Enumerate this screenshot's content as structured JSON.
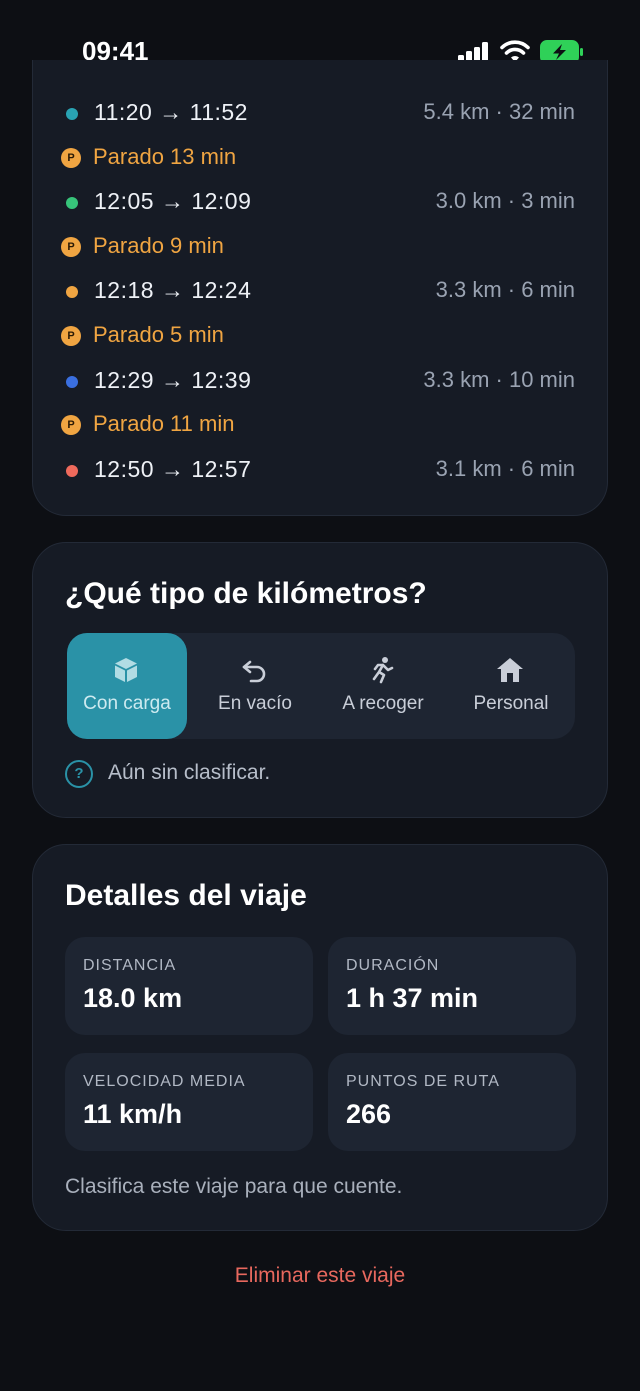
{
  "status_bar": {
    "time": "09:41"
  },
  "trip_segments": [
    {
      "type": "segment",
      "times": "11:20 → 11:52",
      "meta": "5.4 km · 32 min",
      "color": "#29a3b3"
    },
    {
      "type": "stop",
      "label": "Parado 13 min",
      "badge": "P"
    },
    {
      "type": "segment",
      "times": "12:05 → 12:09",
      "meta": "3.0 km · 3 min",
      "color": "#37c47a"
    },
    {
      "type": "stop",
      "label": "Parado 9 min",
      "badge": "P"
    },
    {
      "type": "segment",
      "times": "12:18 → 12:24",
      "meta": "3.3 km · 6 min",
      "color": "#f0a542"
    },
    {
      "type": "stop",
      "label": "Parado 5 min",
      "badge": "P"
    },
    {
      "type": "segment",
      "times": "12:29 → 12:39",
      "meta": "3.3 km · 10 min",
      "color": "#3a6fe0"
    },
    {
      "type": "stop",
      "label": "Parado 11 min",
      "badge": "P"
    },
    {
      "type": "segment",
      "times": "12:50 → 12:57",
      "meta": "3.1 km · 6 min",
      "color": "#ef6a5c"
    }
  ],
  "km_type": {
    "title": "¿Qué tipo de kilómetros?",
    "options": [
      {
        "label": "Con carga",
        "icon": "box-icon",
        "selected": true
      },
      {
        "label": "En vacío",
        "icon": "return-arrow-icon",
        "selected": false
      },
      {
        "label": "A recoger",
        "icon": "running-person-icon",
        "selected": false
      },
      {
        "label": "Personal",
        "icon": "home-icon",
        "selected": false
      }
    ],
    "hint": "Aún sin clasificar.",
    "hint_icon": "?"
  },
  "details": {
    "title": "Detalles del viaje",
    "distance_label": "DISTANCIA",
    "distance": "18.0 km",
    "duration_label": "DURACIÓN",
    "duration": "1 h 37 min",
    "speed_label": "VELOCIDAD MEDIA",
    "speed": "11 km/h",
    "points_label": "PUNTOS DE RUTA",
    "points": "266",
    "note": "Clasifica este viaje para que cuente."
  },
  "delete_label": "Eliminar este viaje",
  "colors": {
    "accent": "#2a92a7",
    "stop": "#f0a542",
    "danger": "#e8685e",
    "card": "#161b25"
  }
}
